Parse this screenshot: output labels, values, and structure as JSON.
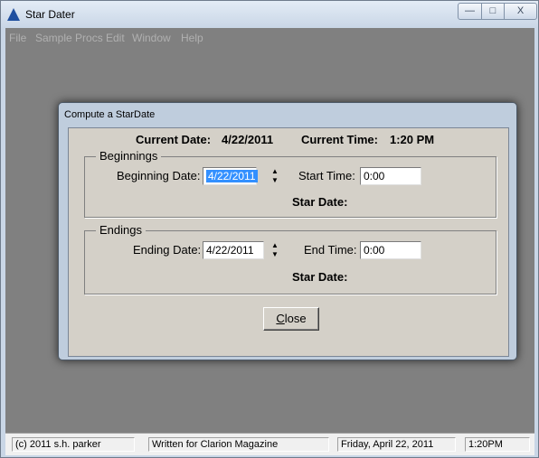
{
  "window": {
    "title": "Star Dater",
    "controls": {
      "minimize": "—",
      "maximize": "□",
      "close": "X"
    }
  },
  "menu": [
    "File",
    "Sample Procs",
    "Edit",
    "Window",
    "Help"
  ],
  "dialog": {
    "title": "Compute a StarDate",
    "current_date_label": "Current Date:",
    "current_date": "4/22/2011",
    "current_time_label": "Current Time:",
    "current_time": "1:20 PM",
    "beginnings": {
      "group_label": "Beginnings",
      "date_label": "Beginning Date:",
      "date_value": "4/22/2011",
      "time_label": "Start Time:",
      "time_value": "0:00",
      "stardate_label": "Star Date:"
    },
    "endings": {
      "group_label": "Endings",
      "date_label": "Ending Date:",
      "date_value": "4/22/2011",
      "time_label": "End Time:",
      "time_value": "0:00",
      "stardate_label": "Star Date:"
    },
    "close_button": {
      "mnemonic": "C",
      "rest": "lose"
    }
  },
  "statusbar": [
    "(c) 2011 s.h. parker",
    "Written for Clarion Magazine",
    "Friday, April 22, 2011",
    "1:20PM"
  ]
}
